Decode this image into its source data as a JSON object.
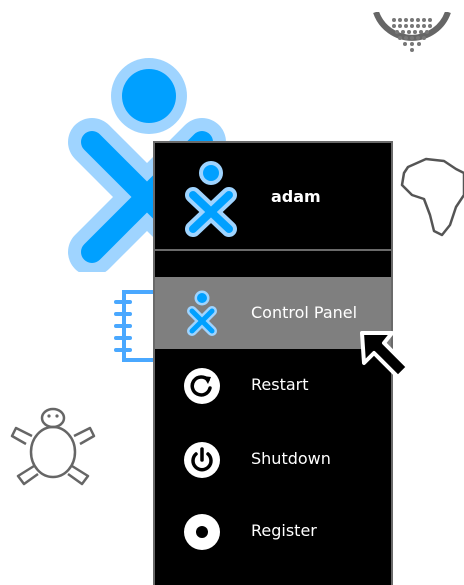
{
  "user": {
    "name": "adam",
    "fill_color": "#00a0ff",
    "stroke_color": "#9fd4ff"
  },
  "menu": {
    "items": [
      {
        "label": "Control Panel",
        "icon": "xo-icon",
        "highlighted": true
      },
      {
        "label": "Restart",
        "icon": "restart-icon",
        "highlighted": false
      },
      {
        "label": "Shutdown",
        "icon": "power-icon",
        "highlighted": false
      },
      {
        "label": "Register",
        "icon": "register-icon",
        "highlighted": false
      }
    ],
    "background": "#000000",
    "highlight_color": "#7f7f7f"
  },
  "background_icons": [
    "globe-grid-icon",
    "africa-map-icon",
    "notebook-icon",
    "turtle-icon"
  ],
  "cursor": "arrow-cursor-icon"
}
